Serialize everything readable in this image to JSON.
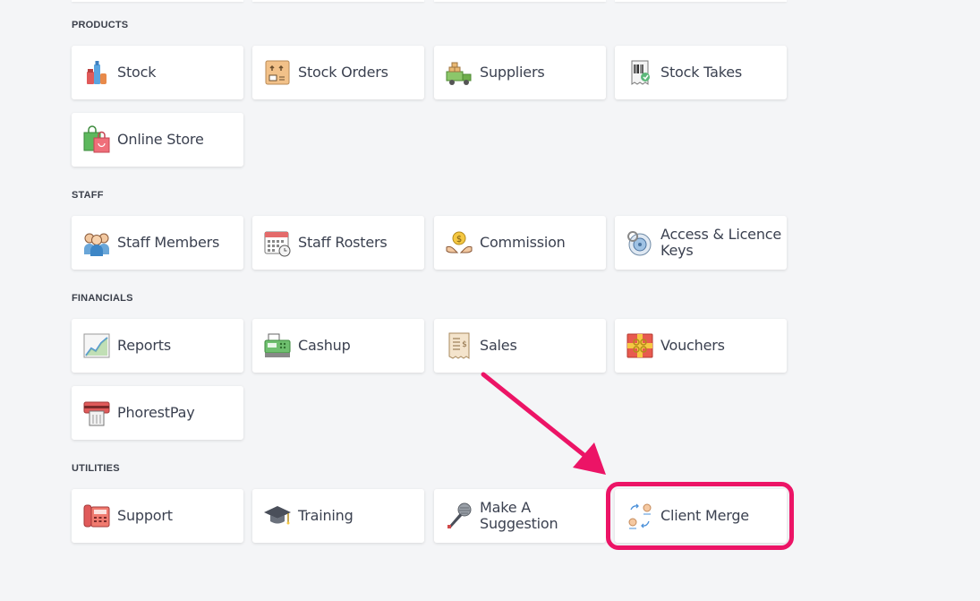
{
  "colors": {
    "background": "#f4f5f7",
    "tile_bg": "#ffffff",
    "text": "#3b4150",
    "highlight": "#ec1466"
  },
  "sections": [
    {
      "id": "products",
      "title": "PRODUCTS",
      "items": [
        {
          "label": "Stock",
          "icon": "stock-icon"
        },
        {
          "label": "Stock Orders",
          "icon": "stock-orders-icon"
        },
        {
          "label": "Suppliers",
          "icon": "suppliers-icon"
        },
        {
          "label": "Stock Takes",
          "icon": "stock-takes-icon"
        },
        {
          "label": "Online Store",
          "icon": "online-store-icon"
        }
      ]
    },
    {
      "id": "staff",
      "title": "STAFF",
      "items": [
        {
          "label": "Staff Members",
          "icon": "staff-members-icon"
        },
        {
          "label": "Staff Rosters",
          "icon": "staff-rosters-icon"
        },
        {
          "label": "Commission",
          "icon": "commission-icon"
        },
        {
          "label": "Access & Licence Keys",
          "icon": "access-keys-icon"
        }
      ]
    },
    {
      "id": "financials",
      "title": "FINANCIALS",
      "items": [
        {
          "label": "Reports",
          "icon": "reports-icon"
        },
        {
          "label": "Cashup",
          "icon": "cashup-icon"
        },
        {
          "label": "Sales",
          "icon": "sales-icon"
        },
        {
          "label": "Vouchers",
          "icon": "vouchers-icon"
        },
        {
          "label": "PhorestPay",
          "icon": "phorestpay-icon"
        }
      ]
    },
    {
      "id": "utilities",
      "title": "UTILITIES",
      "items": [
        {
          "label": "Support",
          "icon": "support-icon"
        },
        {
          "label": "Training",
          "icon": "training-icon"
        },
        {
          "label": "Make A Suggestion",
          "icon": "suggestion-icon"
        },
        {
          "label": "Client Merge",
          "icon": "client-merge-icon"
        }
      ]
    }
  ],
  "annotation": {
    "arrow_icon": "pointer-arrow-icon",
    "highlighted_item": "Client Merge"
  }
}
